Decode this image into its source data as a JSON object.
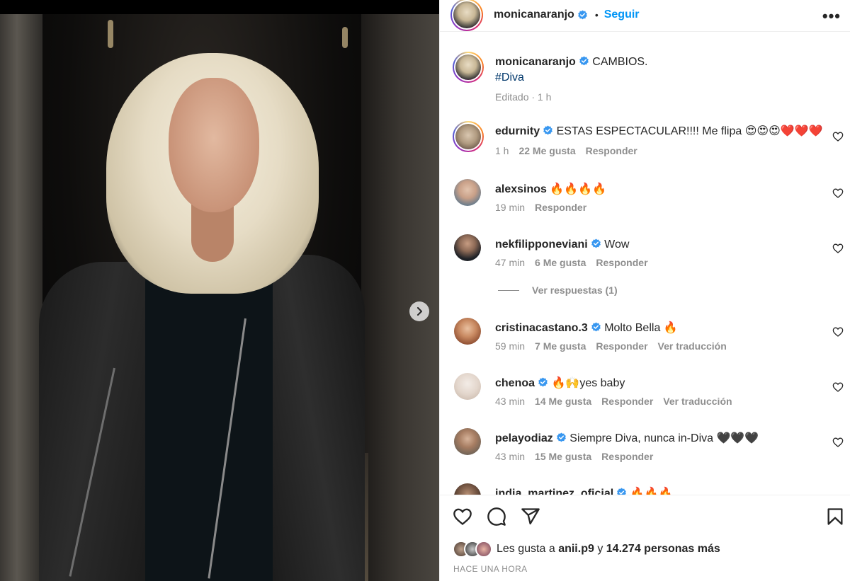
{
  "post": {
    "author": "monicanaranjo",
    "follow_label": "Seguir",
    "more_label": "•••",
    "caption": {
      "text": "CAMBIOS.",
      "hashtag": "#Diva",
      "meta": "Editado · 1 h"
    }
  },
  "comments": [
    {
      "user": "edurnity",
      "verified": true,
      "text": "ESTAS ESPECTACULAR!!!! Me flipa 😍😍😍❤️❤️❤️",
      "time": "1 h",
      "likes": "22 Me gusta",
      "reply": "Responder",
      "translate": ""
    },
    {
      "user": "alexsinos",
      "verified": false,
      "text": "🔥🔥🔥🔥",
      "time": "19 min",
      "likes": "",
      "reply": "Responder",
      "translate": ""
    },
    {
      "user": "nekfilipponeviani",
      "verified": true,
      "text": "Wow",
      "time": "47 min",
      "likes": "6 Me gusta",
      "reply": "Responder",
      "translate": ""
    },
    {
      "user": "cristinacastano.3",
      "verified": true,
      "text": "Molto Bella 🔥",
      "time": "59 min",
      "likes": "7 Me gusta",
      "reply": "Responder",
      "translate": "Ver traducción"
    },
    {
      "user": "chenoa",
      "verified": true,
      "text": "🔥🙌yes baby",
      "time": "43 min",
      "likes": "14 Me gusta",
      "reply": "Responder",
      "translate": "Ver traducción"
    },
    {
      "user": "pelayodiaz",
      "verified": true,
      "text": "Siempre Diva, nunca in-Diva 🖤🖤🖤",
      "time": "43 min",
      "likes": "15 Me gusta",
      "reply": "Responder",
      "translate": ""
    },
    {
      "user": "india_martinez_oficial",
      "verified": true,
      "text": "🔥🔥🔥",
      "time": "",
      "likes": "",
      "reply": "",
      "translate": ""
    }
  ],
  "view_replies": "Ver respuestas (1)",
  "footer": {
    "likes_prefix": "Les gusta a",
    "likes_user": "anii.p9",
    "likes_joiner": "y",
    "likes_rest": "14.274 personas más",
    "time_ago": "HACE UNA HORA"
  },
  "icons": {
    "next": "chevron-right-icon",
    "like": "heart-icon",
    "comment": "comment-icon",
    "share": "send-icon",
    "save": "bookmark-icon",
    "verified": "verified-badge-icon"
  },
  "colors": {
    "link": "#0095f6",
    "hashtag": "#00376b",
    "muted": "#8e8e8e",
    "verified": "#3897f0"
  }
}
